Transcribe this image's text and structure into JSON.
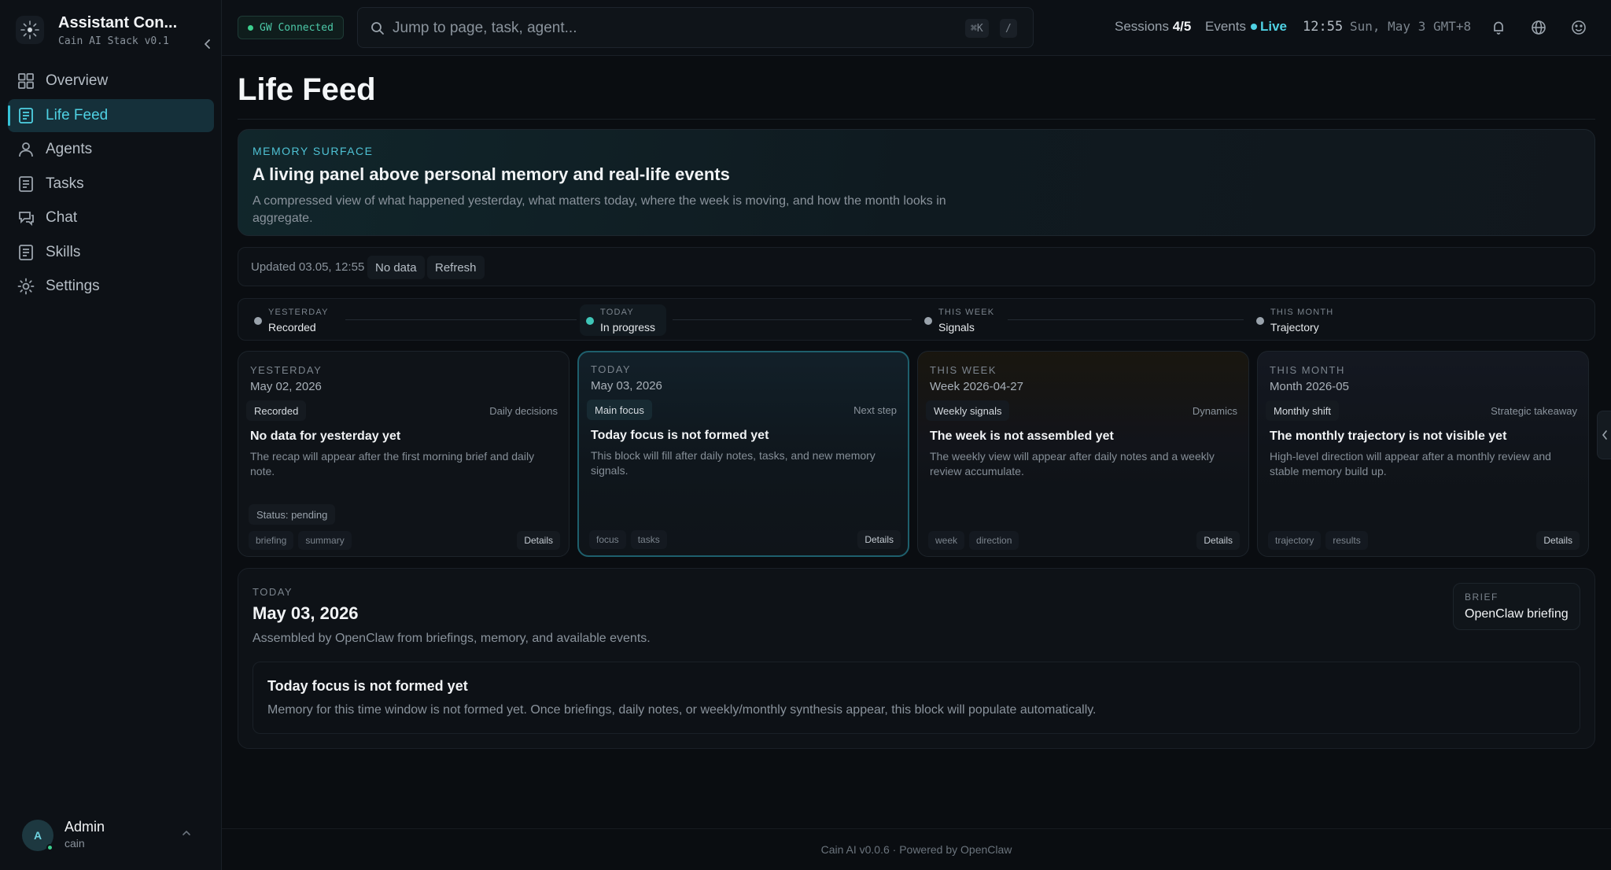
{
  "brand": {
    "title": "Assistant Con...",
    "subtitle": "Cain AI Stack v0.1",
    "icon": "sparkle-logo-icon"
  },
  "nav": [
    {
      "label": "Overview",
      "icon": "grid-icon",
      "active": false
    },
    {
      "label": "Life Feed",
      "icon": "document-icon",
      "active": true
    },
    {
      "label": "Agents",
      "icon": "user-icon",
      "active": false
    },
    {
      "label": "Tasks",
      "icon": "list-icon",
      "active": false
    },
    {
      "label": "Chat",
      "icon": "chat-icon",
      "active": false
    },
    {
      "label": "Skills",
      "icon": "document-icon",
      "active": false
    },
    {
      "label": "Settings",
      "icon": "gear-icon",
      "active": false
    }
  ],
  "user": {
    "initial": "A",
    "name": "Admin",
    "handle": "cain"
  },
  "header": {
    "gw_status": "GW Connected",
    "search_placeholder": "Jump to page, task, agent...",
    "kbd_cmd": "⌘K",
    "kbd_slash": "/",
    "sessions_label": "Sessions",
    "sessions_value": "4/5",
    "events_label": "Events",
    "events_value": "Live",
    "clock": "12:55",
    "date_tz": "Sun, May 3 GMT+8",
    "icons": [
      "bell-icon",
      "globe-icon",
      "smiley-icon"
    ]
  },
  "page": {
    "title": "Life Feed",
    "hero": {
      "kicker": "MEMORY SURFACE",
      "title": "A living panel above personal memory and real-life events",
      "description": "A compressed view of what happened yesterday, what matters today, where the week is moving, and how the month looks in aggregate."
    },
    "status": {
      "updated": "Updated 03.05, 12:55",
      "data_state": "No data",
      "refresh_label": "Refresh"
    },
    "timeline": [
      {
        "kicker": "YESTERDAY",
        "value": "Recorded"
      },
      {
        "kicker": "TODAY",
        "value": "In progress"
      },
      {
        "kicker": "THIS WEEK",
        "value": "Signals"
      },
      {
        "kicker": "THIS MONTH",
        "value": "Trajectory"
      }
    ],
    "cards": [
      {
        "kicker": "YESTERDAY",
        "date": "May 02, 2026",
        "tag": "Recorded",
        "right": "Daily decisions",
        "title": "No data for yesterday yet",
        "description": "The recap will appear after the first morning brief and daily note.",
        "status": "Status: pending",
        "tags": [
          "briefing",
          "summary"
        ],
        "details": "Details"
      },
      {
        "kicker": "TODAY",
        "date": "May 03, 2026",
        "tag": "Main focus",
        "right": "Next step",
        "title": "Today focus is not formed yet",
        "description": "This block will fill after daily notes, tasks, and new memory signals.",
        "tags": [
          "focus",
          "tasks"
        ],
        "details": "Details"
      },
      {
        "kicker": "THIS WEEK",
        "date": "Week 2026-04-27",
        "tag": "Weekly signals",
        "right": "Dynamics",
        "title": "The week is not assembled yet",
        "description": "The weekly view will appear after daily notes and a weekly review accumulate.",
        "tags": [
          "week",
          "direction"
        ],
        "details": "Details"
      },
      {
        "kicker": "THIS MONTH",
        "date": "Month 2026-05",
        "tag": "Monthly shift",
        "right": "Strategic takeaway",
        "title": "The monthly trajectory is not visible yet",
        "description": "High-level direction will appear after a monthly review and stable memory build up.",
        "tags": [
          "trajectory",
          "results"
        ],
        "details": "Details"
      }
    ],
    "today": {
      "kicker": "TODAY",
      "date": "May 03, 2026",
      "subtitle": "Assembled by OpenClaw from briefings, memory, and available events.",
      "brief_kicker": "BRIEF",
      "brief_value": "OpenClaw briefing",
      "focus_title": "Today focus is not formed yet",
      "focus_desc": "Memory for this time window is not formed yet. Once briefings, daily notes, or weekly/monthly synthesis appear, this block will populate automatically."
    }
  },
  "footer": "Cain AI v0.0.6 · Powered by OpenClaw",
  "colors": {
    "accent": "#4fd1e3",
    "live": "#4fd1e3",
    "online": "#3ccf8e",
    "bg": "#0a0d11"
  }
}
